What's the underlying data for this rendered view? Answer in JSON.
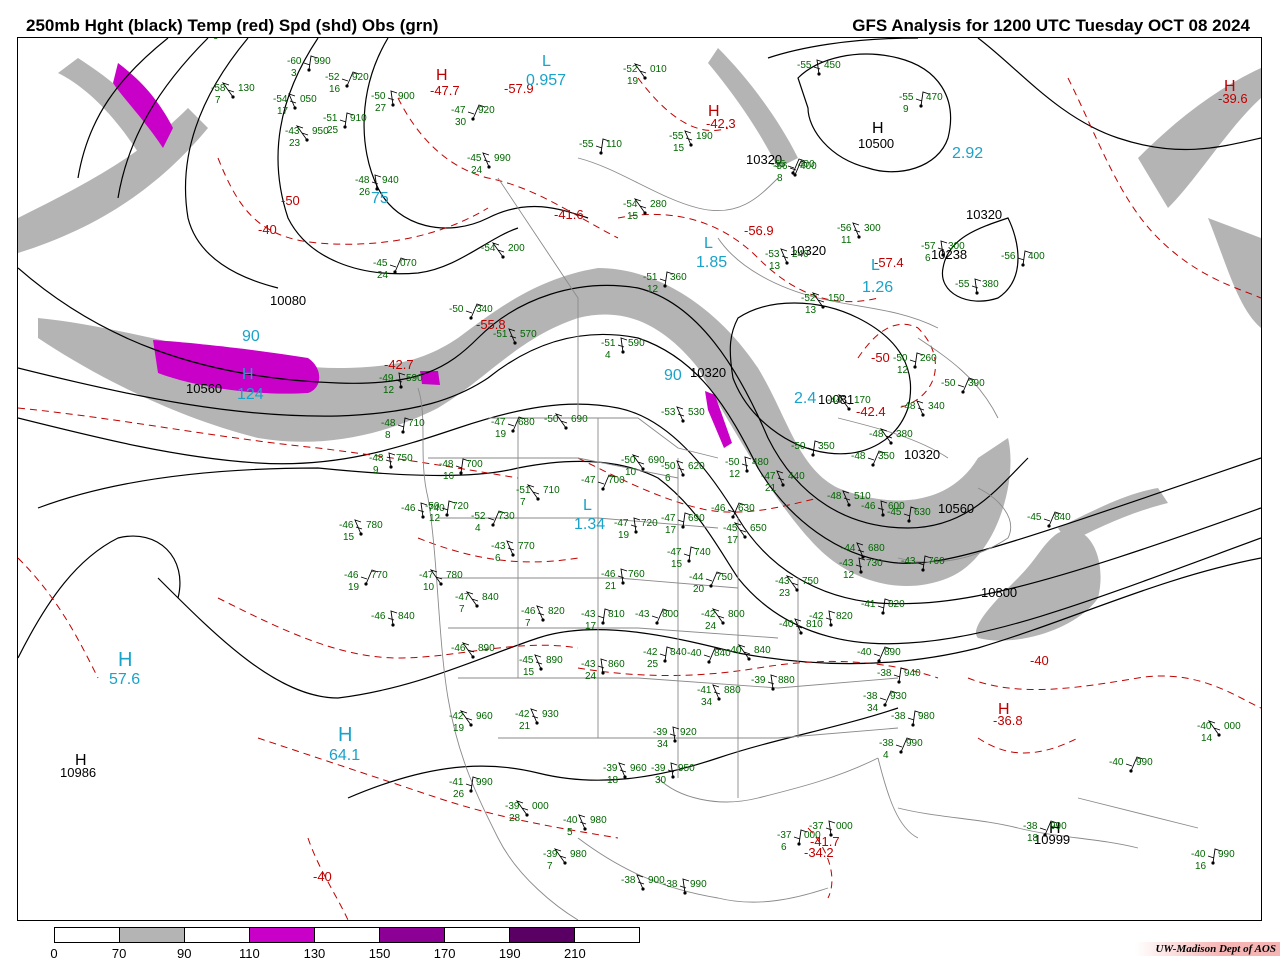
{
  "header": {
    "left_title": "250mb Hght (black) Temp (red) Spd (shd) Obs (grn)",
    "right_title": "GFS Analysis for 1200 UTC Tuesday  OCT 08 2024"
  },
  "colors": {
    "height_contour": "#000000",
    "temp_contour": "#c00000",
    "observation": "#006600",
    "speed_label": "#1aa3c8",
    "speed_70": "#b4b4b4",
    "speed_110": "#c800c8",
    "speed_150": "#8c0096",
    "speed_190": "#5a0064"
  },
  "height_labels": [
    "10080",
    "10560",
    "10320",
    "10500",
    "10320",
    "10238",
    "10320",
    "10320",
    "10081",
    "10320",
    "10560",
    "10800",
    "10986",
    "10999"
  ],
  "temp_labels": [
    "-47.7",
    "-57.9",
    "-41.6",
    "-42.3",
    "-56.9",
    "-50",
    "-55.8",
    "-42.7",
    "-57.4",
    "-50",
    "-42.4",
    "-40",
    "-36.8",
    "-39.6",
    "-40",
    "-40",
    "-41.7",
    "-34.2"
  ],
  "high_low": [
    {
      "letter": "L",
      "value": "0.957",
      "kind": "low"
    },
    {
      "letter": "H",
      "value": "",
      "kind": "high-red"
    },
    {
      "letter": "H",
      "value": "",
      "kind": "high-red"
    },
    {
      "letter": "H",
      "value": "10500",
      "kind": "high"
    },
    {
      "letter": "L",
      "value": "1.85",
      "kind": "low"
    },
    {
      "letter": "L",
      "value": "1.26",
      "kind": "low"
    },
    {
      "letter": "H",
      "value": "124",
      "kind": "high"
    },
    {
      "letter": "L",
      "value": "1.34",
      "kind": "low"
    },
    {
      "letter": "H",
      "value": "57.6",
      "kind": "high"
    },
    {
      "letter": "H",
      "value": "64.1",
      "kind": "high"
    },
    {
      "letter": "H",
      "value": "10986",
      "kind": "high-black"
    },
    {
      "letter": "H",
      "value": "10999",
      "kind": "high-black"
    },
    {
      "letter": "H",
      "value": "-36.8",
      "kind": "high-red"
    },
    {
      "letter": "H",
      "value": "-39.6",
      "kind": "high-red"
    }
  ],
  "speed_labels": [
    "2.92",
    "90",
    "90",
    "2.4",
    "75"
  ],
  "observations": [
    {
      "t": "-60",
      "h": "930",
      "d": "5"
    },
    {
      "t": "-50",
      "h": "870",
      "d": "24"
    },
    {
      "t": "-57",
      "h": "120",
      "d": "9"
    },
    {
      "t": "-60",
      "h": "990",
      "d": "3"
    },
    {
      "t": "-52",
      "h": "920",
      "d": "16"
    },
    {
      "t": "-58",
      "h": "130",
      "d": "7"
    },
    {
      "t": "-54",
      "h": "050",
      "d": "17"
    },
    {
      "t": "-50",
      "h": "900",
      "d": "27"
    },
    {
      "t": "-51",
      "h": "910",
      "d": "25"
    },
    {
      "t": "-47",
      "h": "920",
      "d": "30"
    },
    {
      "t": "-43",
      "h": "950",
      "d": "23"
    },
    {
      "t": "-45",
      "h": "990",
      "d": "24"
    },
    {
      "t": "-48",
      "h": "940",
      "d": "26"
    },
    {
      "t": "-55",
      "h": "110",
      "d": ""
    },
    {
      "t": "-55",
      "h": "400",
      "d": ""
    },
    {
      "t": "-52",
      "h": "010",
      "d": "19"
    },
    {
      "t": "-55",
      "h": "190",
      "d": "15"
    },
    {
      "t": "-55",
      "h": "450",
      "d": ""
    },
    {
      "t": "-55",
      "h": "470",
      "d": "9"
    },
    {
      "t": "-56",
      "h": "400",
      "d": "8"
    },
    {
      "t": "-54",
      "h": "280",
      "d": "15"
    },
    {
      "t": "-56",
      "h": "300",
      "d": "11"
    },
    {
      "t": "-57",
      "h": "300",
      "d": "6"
    },
    {
      "t": "-56",
      "h": "400",
      "d": ""
    },
    {
      "t": "-45",
      "h": "070",
      "d": "24"
    },
    {
      "t": "-54",
      "h": "200",
      "d": ""
    },
    {
      "t": "-53",
      "h": "240",
      "d": "13"
    },
    {
      "t": "-55",
      "h": "380",
      "d": ""
    },
    {
      "t": "-51",
      "h": "360",
      "d": "12"
    },
    {
      "t": "-50",
      "h": "340",
      "d": ""
    },
    {
      "t": "-52",
      "h": "150",
      "d": "13"
    },
    {
      "t": "-51",
      "h": "570",
      "d": ""
    },
    {
      "t": "-51",
      "h": "590",
      "d": "4"
    },
    {
      "t": "-50",
      "h": "260",
      "d": "12"
    },
    {
      "t": "-50",
      "h": "390",
      "d": ""
    },
    {
      "t": "-44",
      "h": "170",
      "d": ""
    },
    {
      "t": "-48",
      "h": "340",
      "d": ""
    },
    {
      "t": "-49",
      "h": "590",
      "d": "12"
    },
    {
      "t": "-48",
      "h": "710",
      "d": "8"
    },
    {
      "t": "-47",
      "h": "680",
      "d": "19"
    },
    {
      "t": "-50",
      "h": "690",
      "d": ""
    },
    {
      "t": "-53",
      "h": "530",
      "d": ""
    },
    {
      "t": "-48",
      "h": "750",
      "d": "9"
    },
    {
      "t": "-48",
      "h": "700",
      "d": "16"
    },
    {
      "t": "-47",
      "h": "700",
      "d": ""
    },
    {
      "t": "-50",
      "h": "690",
      "d": "10"
    },
    {
      "t": "-50",
      "h": "620",
      "d": "6"
    },
    {
      "t": "-50",
      "h": "480",
      "d": "12"
    },
    {
      "t": "-50",
      "h": "350",
      "d": ""
    },
    {
      "t": "-48",
      "h": "350",
      "d": ""
    },
    {
      "t": "-48",
      "h": "380",
      "d": ""
    },
    {
      "t": "-47",
      "h": "440",
      "d": "21"
    },
    {
      "t": "-46",
      "h": "740",
      "d": ""
    },
    {
      "t": "-50",
      "h": "720",
      "d": "12"
    },
    {
      "t": "-52",
      "h": "730",
      "d": "4"
    },
    {
      "t": "-51",
      "h": "710",
      "d": "7"
    },
    {
      "t": "-46",
      "h": "780",
      "d": "15"
    },
    {
      "t": "-47",
      "h": "720",
      "d": "19"
    },
    {
      "t": "-47",
      "h": "690",
      "d": "17"
    },
    {
      "t": "-46",
      "h": "630",
      "d": ""
    },
    {
      "t": "-45",
      "h": "650",
      "d": "17"
    },
    {
      "t": "-48",
      "h": "510",
      "d": ""
    },
    {
      "t": "-46",
      "h": "600",
      "d": ""
    },
    {
      "t": "-45",
      "h": "630",
      "d": ""
    },
    {
      "t": "-46",
      "h": "770",
      "d": "19"
    },
    {
      "t": "-47",
      "h": "780",
      "d": "10"
    },
    {
      "t": "-43",
      "h": "770",
      "d": "6"
    },
    {
      "t": "-46",
      "h": "760",
      "d": "21"
    },
    {
      "t": "-47",
      "h": "740",
      "d": "15"
    },
    {
      "t": "-44",
      "h": "750",
      "d": "20"
    },
    {
      "t": "-43",
      "h": "750",
      "d": "23"
    },
    {
      "t": "-44",
      "h": "680",
      "d": ""
    },
    {
      "t": "-43",
      "h": "730",
      "d": "12"
    },
    {
      "t": "-43",
      "h": "760",
      "d": ""
    },
    {
      "t": "-45",
      "h": "840",
      "d": ""
    },
    {
      "t": "-47",
      "h": "840",
      "d": "7"
    },
    {
      "t": "-46",
      "h": "820",
      "d": "7"
    },
    {
      "t": "-46",
      "h": "840",
      "d": ""
    },
    {
      "t": "-43",
      "h": "810",
      "d": "17"
    },
    {
      "t": "-43",
      "h": "800",
      "d": ""
    },
    {
      "t": "-42",
      "h": "800",
      "d": "24"
    },
    {
      "t": "-40",
      "h": "810",
      "d": ""
    },
    {
      "t": "-42",
      "h": "820",
      "d": ""
    },
    {
      "t": "-41",
      "h": "820",
      "d": ""
    },
    {
      "t": "-40",
      "h": "890",
      "d": ""
    },
    {
      "t": "-46",
      "h": "890",
      "d": ""
    },
    {
      "t": "-45",
      "h": "890",
      "d": "15"
    },
    {
      "t": "-43",
      "h": "860",
      "d": "24"
    },
    {
      "t": "-42",
      "h": "840",
      "d": "25"
    },
    {
      "t": "-40",
      "h": "840",
      "d": ""
    },
    {
      "t": "-40",
      "h": "840",
      "d": ""
    },
    {
      "t": "-41",
      "h": "880",
      "d": "34"
    },
    {
      "t": "-39",
      "h": "880",
      "d": ""
    },
    {
      "t": "-38",
      "h": "940",
      "d": ""
    },
    {
      "t": "-38",
      "h": "930",
      "d": "34"
    },
    {
      "t": "-42",
      "h": "960",
      "d": "19"
    },
    {
      "t": "-42",
      "h": "930",
      "d": "21"
    },
    {
      "t": "-39",
      "h": "920",
      "d": "34"
    },
    {
      "t": "-38",
      "h": "980",
      "d": ""
    },
    {
      "t": "-38",
      "h": "990",
      "d": "4"
    },
    {
      "t": "-40",
      "h": "000",
      "d": "14"
    },
    {
      "t": "-39",
      "h": "960",
      "d": "18"
    },
    {
      "t": "-39",
      "h": "950",
      "d": "30"
    },
    {
      "t": "-41",
      "h": "990",
      "d": "26"
    },
    {
      "t": "-40",
      "h": "990",
      "d": ""
    },
    {
      "t": "-39",
      "h": "000",
      "d": "28"
    },
    {
      "t": "-40",
      "h": "980",
      "d": "5"
    },
    {
      "t": "-37",
      "h": "000",
      "d": ""
    },
    {
      "t": "-37",
      "h": "000",
      "d": "6"
    },
    {
      "t": "-38",
      "h": "990",
      "d": "18"
    },
    {
      "t": "-39",
      "h": "980",
      "d": "7"
    },
    {
      "t": "-38",
      "h": "900",
      "d": ""
    },
    {
      "t": "-38",
      "h": "990",
      "d": ""
    },
    {
      "t": "-40",
      "h": "990",
      "d": "16"
    }
  ],
  "legend": {
    "ticks": [
      "0",
      "70",
      "90",
      "110",
      "130",
      "150",
      "170",
      "190",
      "210"
    ],
    "segment_colors": [
      "#ffffff",
      "#b4b4b4",
      "#ffffff",
      "#c800c8",
      "#ffffff",
      "#8c0096",
      "#ffffff",
      "#5a0064",
      "#ffffff"
    ]
  },
  "credit": "UW-Madison   Dept of AOS"
}
